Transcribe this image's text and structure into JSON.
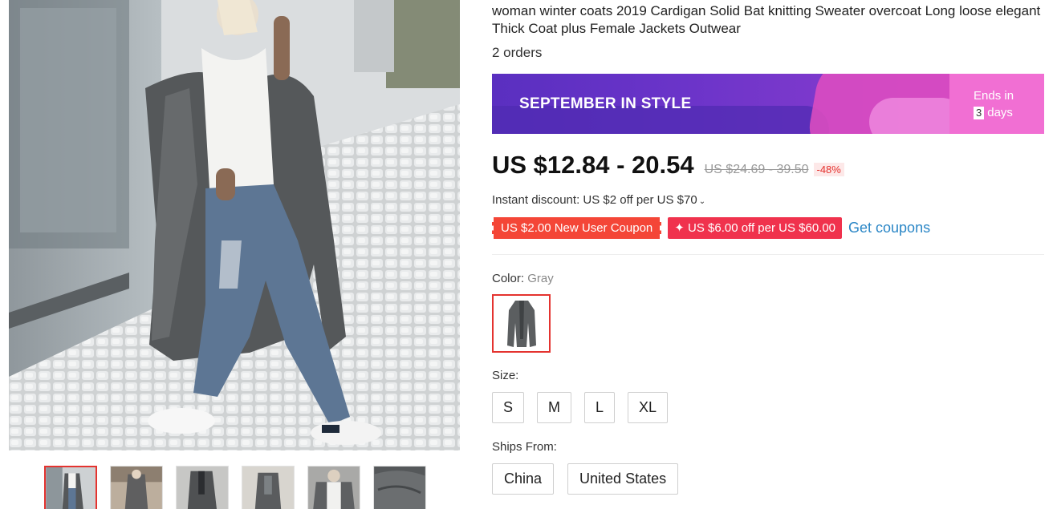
{
  "product": {
    "title": "woman winter coats 2019 Cardigan Solid Bat knitting Sweater overcoat Long loose elegant Thick Coat plus Female Jackets Outwear",
    "orders": "2 orders"
  },
  "banner": {
    "title": "SEPTEMBER IN STYLE",
    "ends_in": "Ends in",
    "days_count": "3",
    "days_label": "days",
    "colors": {
      "purple": "#6b34c9",
      "pink": "#f16fd3"
    }
  },
  "price": {
    "current": "US $12.84 - 20.54",
    "original": "US $24.69 - 39.50",
    "discount": "-48%"
  },
  "instant_discount": {
    "text": "Instant discount: US $2 off per US $70",
    "icon": "chevron-down-icon"
  },
  "coupons": {
    "new_user": "US $2.00 New User Coupon",
    "off_per": "✦ US $6.00 off per US $60.00",
    "get_coupons": "Get coupons"
  },
  "color": {
    "label": "Color:",
    "selected": "Gray"
  },
  "size": {
    "label": "Size:",
    "options": [
      "S",
      "M",
      "L",
      "XL"
    ]
  },
  "ships_from": {
    "label": "Ships From:",
    "options": [
      "China",
      "United States"
    ]
  },
  "accent_colors": {
    "red": "#e4332f",
    "link": "#2a86c6"
  }
}
